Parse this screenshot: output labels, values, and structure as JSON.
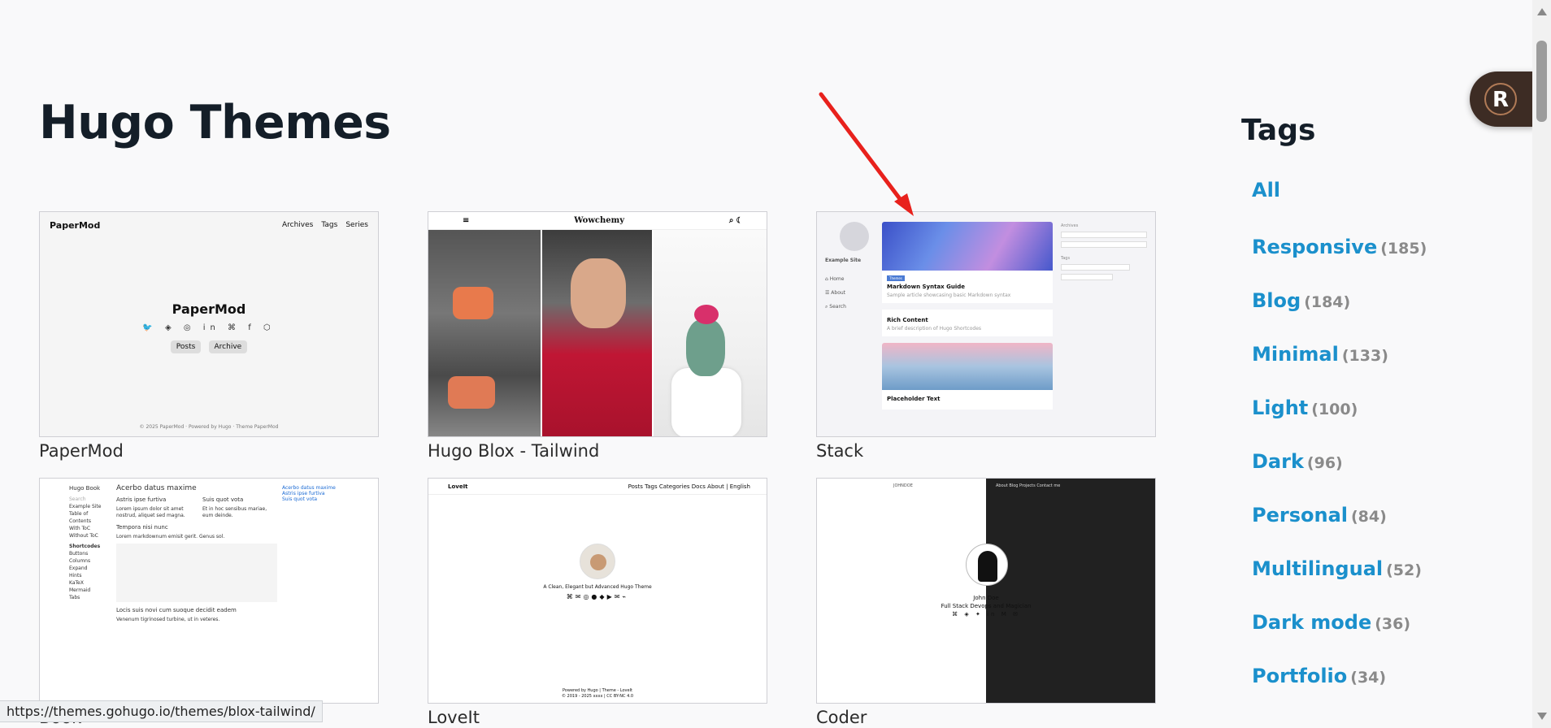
{
  "page": {
    "title": "Hugo Themes"
  },
  "themes": [
    {
      "name": "PaperMod"
    },
    {
      "name": "Hugo Blox - Tailwind"
    },
    {
      "name": "Stack"
    },
    {
      "name": "Book"
    },
    {
      "name": "LoveIt"
    },
    {
      "name": "Coder"
    }
  ],
  "previews": {
    "papermod": {
      "brand": "PaperMod",
      "nav": [
        "Archives",
        "Tags",
        "Series"
      ],
      "heading": "PaperMod",
      "btn_posts": "Posts",
      "btn_archive": "Archive",
      "footer": "© 2025 PaperMod · Powered by Hugo · Theme PaperMod"
    },
    "blox": {
      "brand": "Wowchemy"
    },
    "stack": {
      "site": "Example Site",
      "post1": "Markdown Syntax Guide",
      "post2": "Rich Content",
      "post3": "Placeholder Text"
    },
    "book": {
      "brand": "Hugo Book",
      "title": "Acerbo datus maxime",
      "h_a": "Astris ipse furtiva",
      "h_b": "Suis quot vota",
      "h_c": "Tempora nisi nunc",
      "h_d": "Locis suis novi cum suoque decidit eadem"
    },
    "loveit": {
      "brand": "LoveIt",
      "nav": "Posts  Tags  Categories  Docs  About",
      "lang": "English",
      "tagline": "A Clean, Elegant but Advanced Hugo Theme",
      "foot1": "Powered by Hugo | Theme - LoveIt",
      "foot2": "© 2019 - 2025 xxxx | CC BY-NC 4.0"
    },
    "coder": {
      "brand": "JOHNDOE",
      "nav": "About  Blog  Projects  Contact me",
      "name": "John Doe",
      "role": "Full Stack Devops and Magician"
    }
  },
  "tags": {
    "title": "Tags",
    "items": [
      {
        "label": "All",
        "count": ""
      },
      {
        "label": "Responsive",
        "count": "(185)"
      },
      {
        "label": "Blog",
        "count": "(184)"
      },
      {
        "label": "Minimal",
        "count": "(133)"
      },
      {
        "label": "Light",
        "count": "(100)"
      },
      {
        "label": "Dark",
        "count": "(96)"
      },
      {
        "label": "Personal",
        "count": "(84)"
      },
      {
        "label": "Multilingual",
        "count": "(52)"
      },
      {
        "label": "Dark mode",
        "count": "(36)"
      },
      {
        "label": "Portfolio",
        "count": "(34)"
      }
    ]
  },
  "status": {
    "url": "https://themes.gohugo.io/themes/blox-tailwind/"
  },
  "fab": {
    "letter": "R"
  },
  "colors": {
    "tag_link": "#1b90cc",
    "arrow": "#e8211c"
  }
}
